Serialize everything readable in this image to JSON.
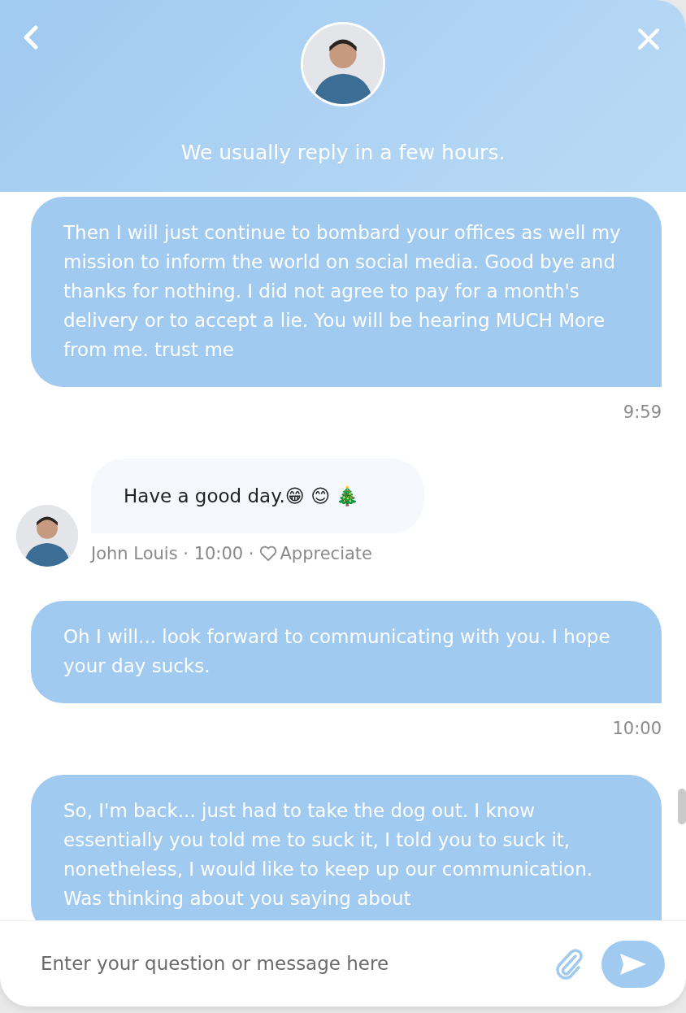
{
  "header": {
    "subtitle": "We usually reply in a few hours."
  },
  "messages": [
    {
      "kind": "visitor",
      "text": "Then I will just continue to bombard your offices as well my mission to inform the world on social media. Good bye and thanks for nothing. I did not agree to pay for a month's delivery or to accept a lie. You will be hearing MUCH More from me. trust me",
      "time": "9:59"
    },
    {
      "kind": "agent",
      "text": "Have a good day.😁 😊 🎄",
      "byline": "John Louis · 10:00 ·",
      "action": "Appreciate"
    },
    {
      "kind": "visitor",
      "text": "Oh I will... look forward to communicating with you. I hope your day sucks.",
      "time": "10:00"
    },
    {
      "kind": "visitor",
      "text": "So, I'm back... just had to take the dog out. I know essentially you told me to suck it, I told you to suck it, nonetheless, I would like to keep up our communication. Was thinking about you saying about"
    }
  ],
  "composer": {
    "placeholder": "Enter your question or message here"
  }
}
